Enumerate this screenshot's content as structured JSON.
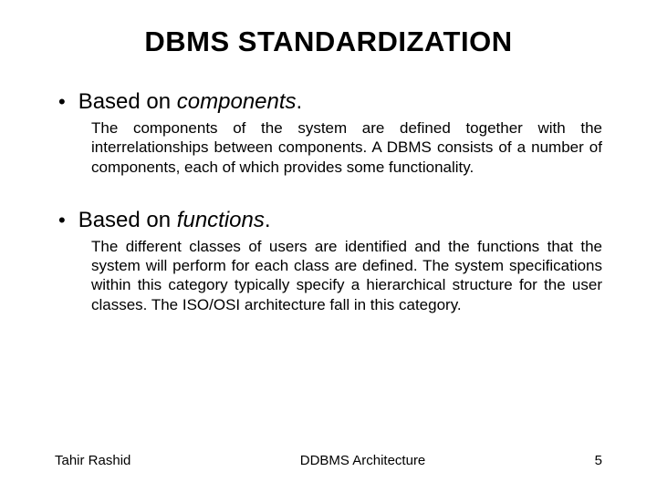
{
  "title": "DBMS STANDARDIZATION",
  "bullets": [
    {
      "lead": "Based on ",
      "em": "components",
      "tail": ".",
      "body": "The components of the system are defined together with the interrelationships between components. A DBMS consists of a number of components, each of which provides some functionality."
    },
    {
      "lead": "Based on ",
      "em": "functions",
      "tail": ".",
      "body": "The different classes of users are identified and the functions that the system will perform for each class are defined. The system specifications within this category typically specify a hierarchical structure for the user classes. The ISO/OSI architecture fall in this category."
    }
  ],
  "footer": {
    "author": "Tahir Rashid",
    "center": "DDBMS Architecture",
    "page": "5"
  }
}
